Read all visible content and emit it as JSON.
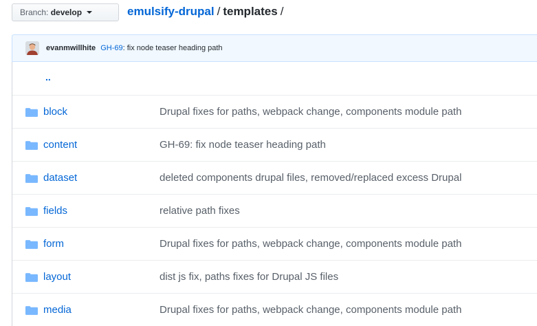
{
  "branch": {
    "prefix": "Branch:",
    "name": "develop"
  },
  "breadcrumb": {
    "repo": "emulsify-drupal",
    "sep1": "/",
    "path": "templates",
    "sep2": "/"
  },
  "latest_commit": {
    "author": "evanmwillhite",
    "issue": "GH-69",
    "message": ": fix node teaser heading path"
  },
  "up_link": "..",
  "files": [
    {
      "name": "block",
      "message": "Drupal fixes for paths, webpack change, components module path"
    },
    {
      "name": "content",
      "message": "GH-69: fix node teaser heading path"
    },
    {
      "name": "dataset",
      "message": "deleted components drupal files, removed/replaced excess Drupal"
    },
    {
      "name": "fields",
      "message": "relative path fixes"
    },
    {
      "name": "form",
      "message": "Drupal fixes for paths, webpack change, components module path"
    },
    {
      "name": "layout",
      "message": "dist js fix, paths fixes for Drupal JS files"
    },
    {
      "name": "media",
      "message": "Drupal fixes for paths, webpack change, components module path"
    }
  ],
  "colors": {
    "link": "#0366d6",
    "folder": "#79b8ff",
    "commit_bg": "#f1f8ff",
    "muted": "#586069"
  },
  "icons": {
    "folder": "folder-icon",
    "caret": "caret-down-icon",
    "avatar": "user-avatar"
  }
}
